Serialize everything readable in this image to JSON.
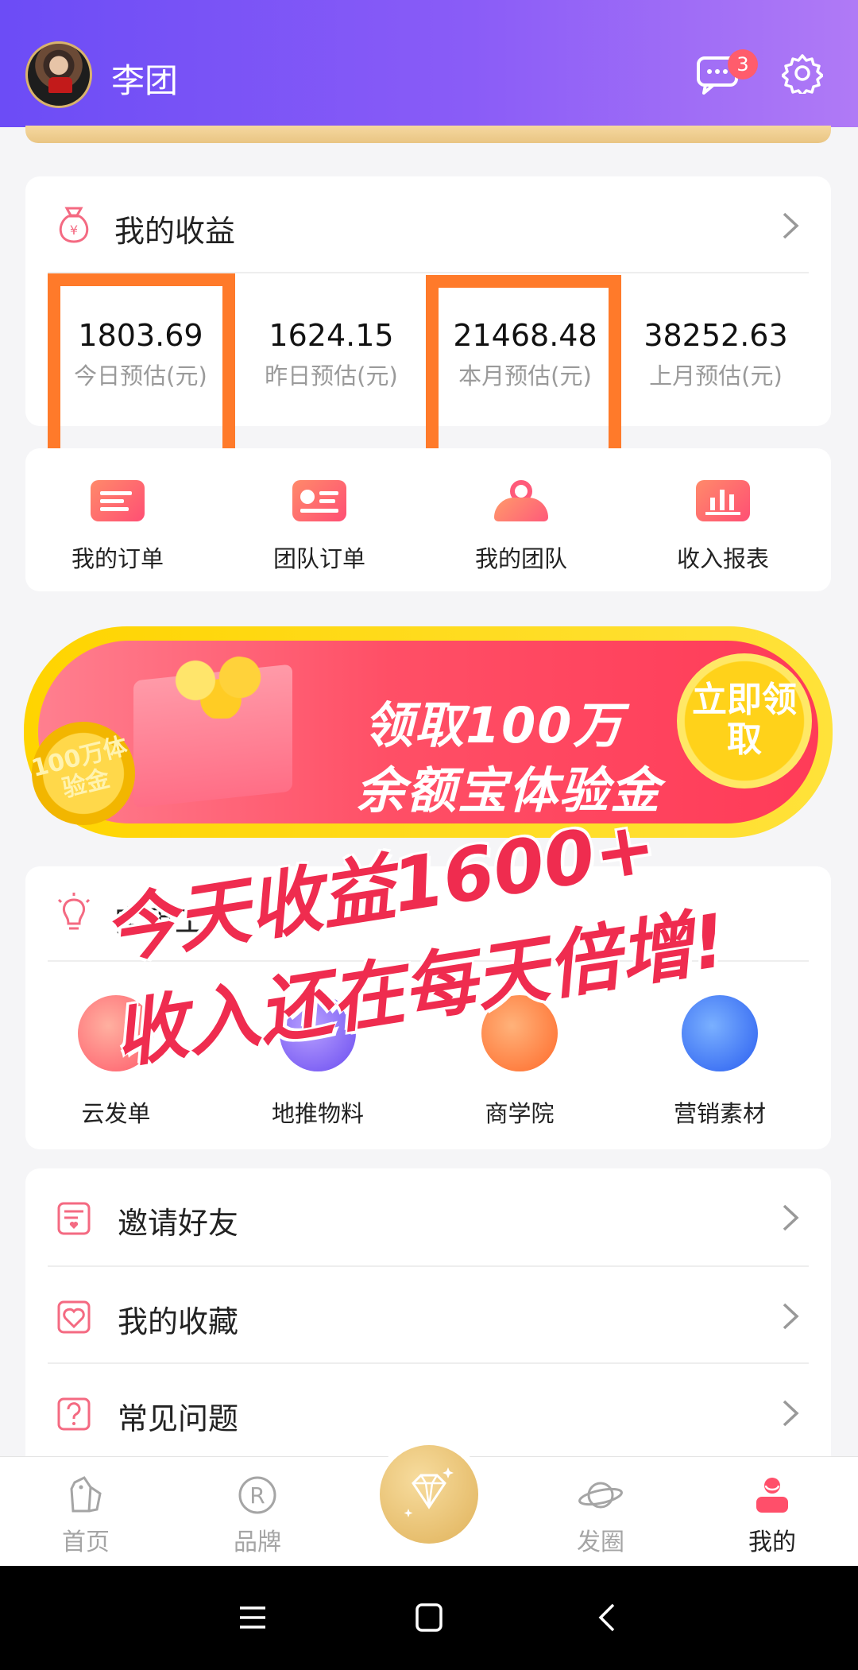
{
  "header": {
    "username": "李团",
    "message_badge": "3",
    "gradient": [
      "#6c4cf6",
      "#b07af6"
    ]
  },
  "earnings": {
    "title": "我的收益",
    "stats": [
      {
        "value": "1803.69",
        "label": "今日预估(元)"
      },
      {
        "value": "1624.15",
        "label": "昨日预估(元)"
      },
      {
        "value": "21468.48",
        "label": "本月预估(元)"
      },
      {
        "value": "38252.63",
        "label": "上月预估(元)"
      }
    ],
    "highlight_color": "#ff7a2a"
  },
  "quick_actions": [
    {
      "label": "我的订单",
      "icon": "order-icon"
    },
    {
      "label": "团队订单",
      "icon": "team-order-icon"
    },
    {
      "label": "我的团队",
      "icon": "team-icon"
    },
    {
      "label": "收入报表",
      "icon": "report-icon"
    }
  ],
  "banner": {
    "line1": "领取100万",
    "line2": "余额宝体验金",
    "button": "立即领取",
    "coin_text": "100万体验金"
  },
  "tools": {
    "title": "实用工具",
    "items": [
      {
        "label": "云发单",
        "icon": "cloud-send-icon"
      },
      {
        "label": "地推物料",
        "icon": "materials-icon"
      },
      {
        "label": "商学院",
        "icon": "academy-icon"
      },
      {
        "label": "营销素材",
        "icon": "marketing-icon"
      }
    ]
  },
  "overlay": {
    "line1": "今天收益1600+",
    "line2": "收入还在每天倍增!"
  },
  "menu": [
    {
      "label": "邀请好友",
      "icon": "invite-icon"
    },
    {
      "label": "我的收藏",
      "icon": "favorite-icon"
    },
    {
      "label": "常见问题",
      "icon": "faq-icon"
    }
  ],
  "tabbar": [
    {
      "label": "首页",
      "icon": "home-bag-icon"
    },
    {
      "label": "品牌",
      "icon": "brand-icon"
    },
    {
      "label": "",
      "icon": "diamond-icon"
    },
    {
      "label": "发圈",
      "icon": "planet-icon"
    },
    {
      "label": "我的",
      "icon": "profile-icon",
      "active": true
    }
  ],
  "accent": "#ff5a6e"
}
